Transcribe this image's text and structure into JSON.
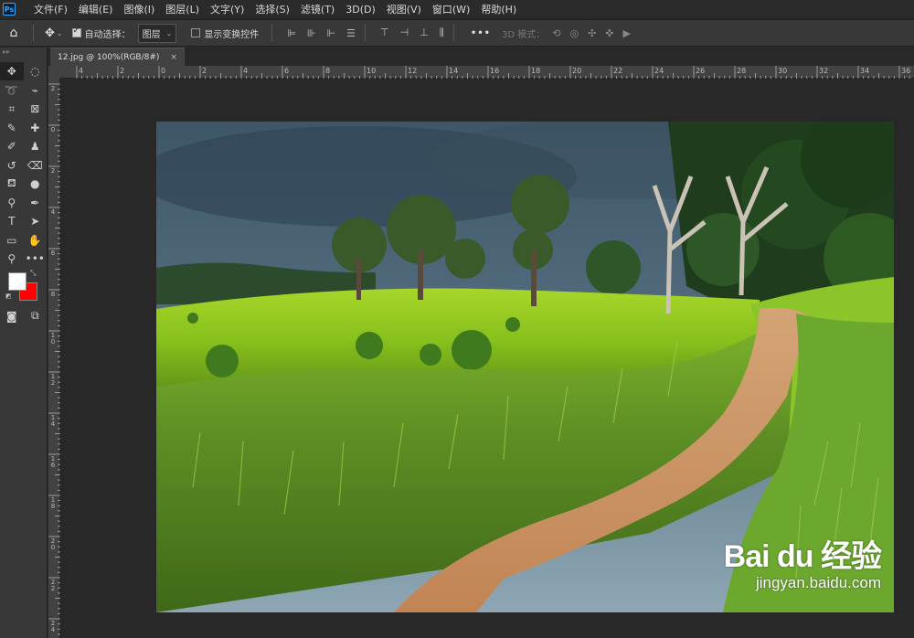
{
  "menubar": {
    "app_icon": "Ps",
    "items": [
      "文件(F)",
      "编辑(E)",
      "图像(I)",
      "图层(L)",
      "文字(Y)",
      "选择(S)",
      "滤镜(T)",
      "3D(D)",
      "视图(V)",
      "窗口(W)",
      "帮助(H)"
    ]
  },
  "options": {
    "auto_select_label": "自动选择：",
    "auto_select_checked": true,
    "auto_select_value": "图层",
    "show_transform_label": "显示变换控件",
    "show_transform_checked": false,
    "mode3d_label": "3D 模式："
  },
  "document": {
    "tab_title": "12.jpg @ 100%(RGB/8#)",
    "close_glyph": "×"
  },
  "rulers": {
    "h_labels": [
      "4",
      "2",
      "0",
      "2",
      "4",
      "6",
      "8",
      "10",
      "12",
      "14",
      "16",
      "18",
      "20",
      "22",
      "24",
      "26",
      "28",
      "30",
      "32",
      "34",
      "36"
    ],
    "v_labels": [
      "2",
      "0",
      "2",
      "4",
      "6",
      "8",
      "1\n0",
      "1\n2",
      "1\n4",
      "1\n6",
      "1\n8",
      "2\n0",
      "2\n2",
      "2\n4"
    ]
  },
  "swatches": {
    "foreground": "#ffffff",
    "background": "#ff0000"
  },
  "watermark": {
    "main": "Bai du 经验",
    "sub": "jingyan.baidu.com"
  }
}
